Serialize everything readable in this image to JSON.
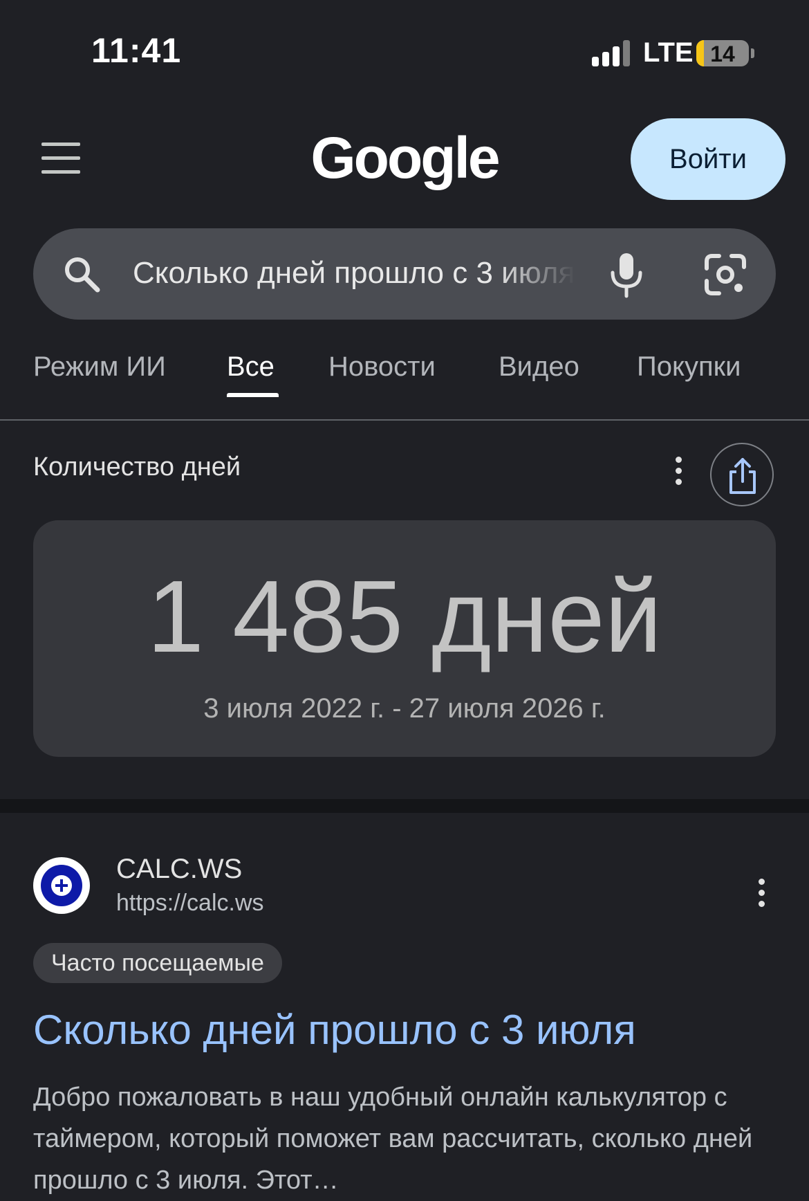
{
  "status_bar": {
    "time": "11:41",
    "network": "LTE",
    "battery_level": "14",
    "battery_fraction": 0.14
  },
  "header": {
    "menu_icon": "hamburger-menu-icon",
    "logo": "Google",
    "sign_in_label": "Войти"
  },
  "search": {
    "query": "Сколько дней прошло с 3 июля",
    "search_icon": "search-icon",
    "mic_icon": "microphone-icon",
    "lens_icon": "camera-lens-icon"
  },
  "tabs": [
    {
      "label": "Режим ИИ",
      "active": false
    },
    {
      "label": "Все",
      "active": true
    },
    {
      "label": "Новости",
      "active": false
    },
    {
      "label": "Видео",
      "active": false
    },
    {
      "label": "Покупки",
      "active": false
    }
  ],
  "day_counter": {
    "title": "Количество дней",
    "value": "1 485 дней",
    "range": "3 июля 2022 г. - 27 июля 2026 г."
  },
  "result": {
    "site_name": "CALC.WS",
    "site_url": "https://calc.ws",
    "badge": "Часто посещаемые",
    "title": "Сколько дней прошло с 3 июля",
    "snippet": "Добро пожаловать в наш удобный онлайн калькулятор с таймером, который поможет вам рассчитать, сколько дней прошло с 3 июля. Этот…"
  },
  "colors": {
    "background": "#1f2025",
    "link": "#99c3ff",
    "sign_in_bg": "#c7e7fe",
    "battery_low": "#f5c518"
  }
}
